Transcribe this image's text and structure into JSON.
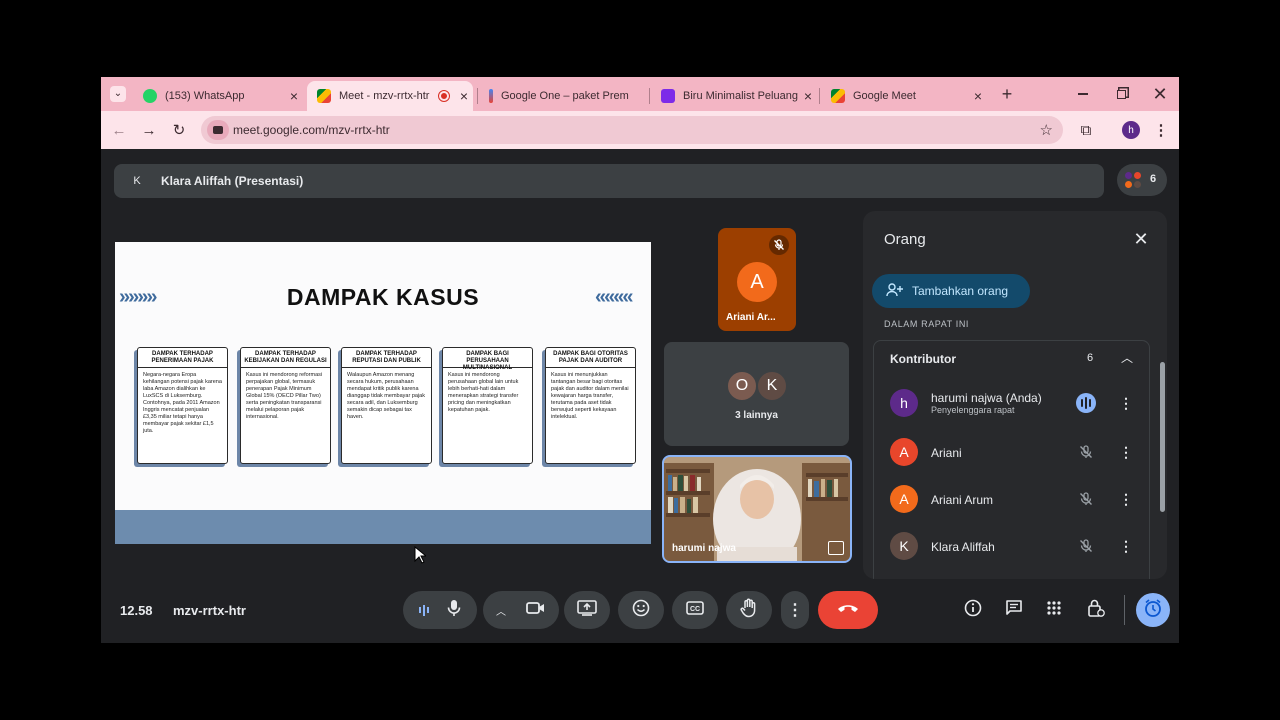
{
  "tabs": [
    {
      "title": "(153) WhatsApp",
      "active": false
    },
    {
      "title": "Meet - mzv-rrtx-htr",
      "active": true
    },
    {
      "title": "Google One – paket Prem",
      "active": false
    },
    {
      "title": "Biru Minimalist Peluang da",
      "active": false
    },
    {
      "title": "Google Meet",
      "active": false
    }
  ],
  "address": {
    "url": "meet.google.com/mzv-rrtx-htr"
  },
  "profile_initial": "h",
  "presenter": {
    "initial": "K",
    "label": "Klara Aliffah (Presentasi)"
  },
  "participant_count": "6",
  "slide": {
    "title": "DAMPAK KASUS",
    "left_chevrons": "»»»»",
    "right_chevrons": "««««",
    "cards": [
      {
        "heading": "DAMPAK TERHADAP PENERIMAAN PAJAK",
        "body": "Negara-negara Eropa kehilangan potensi pajak karena laba Amazon dialihkan ke LuxSCS di Luksemburg. Contohnya, pada 2011 Amazon Inggris mencatat penjualan £3,35 miliar tetapi hanya membayar pajak sekitar £1,5 juta."
      },
      {
        "heading": "DAMPAK TERHADAP KEBIJAKAN DAN REGULASI",
        "body": "Kasus ini mendorong reformasi perpajakan global, termasuk penerapan Pajak Minimum Global 15% (OECD Pillar Two) serta peningkatan transparansi melalui pelaporan pajak internasional."
      },
      {
        "heading": "DAMPAK TERHADAP REPUTASI DAN PUBLIK",
        "body": "Walaupun Amazon menang secara hukum, perusahaan mendapat kritik publik karena dianggap tidak membayar pajak secara adil, dan Luksemburg semakin dicap sebagai tax haven."
      },
      {
        "heading": "DAMPAK BAGI PERUSAHAAN MULTINASIONAL",
        "body": "Kasus ini mendorong perusahaan global lain untuk lebih berhati-hati dalam menerapkan strategi transfer pricing dan meningkatkan kepatuhan pajak."
      },
      {
        "heading": "DAMPAK BAGI OTORITAS PAJAK DAN AUDITOR",
        "body": "Kasus ini menunjukkan tantangan besar bagi otoritas pajak dan auditor dalam menilai kewajaran harga transfer, terutama pada aset tidak berwujud seperti kekayaan intelektual."
      }
    ]
  },
  "tiles": {
    "ariani": {
      "initial": "A",
      "name": "Ariani Ar..."
    },
    "more": {
      "initials": [
        "O",
        "K"
      ],
      "label": "3 lainnya"
    },
    "self": {
      "name": "harumi najwa"
    }
  },
  "panel": {
    "title": "Orang",
    "add_button": "Tambahkan orang",
    "section_label": "DALAM RAPAT INI",
    "group_label": "Kontributor",
    "group_count": "6",
    "people": [
      {
        "initial": "h",
        "name": "harumi najwa (Anda)",
        "sub": "Penyelenggara rapat",
        "color": "#5d2a8a",
        "speaking": true
      },
      {
        "initial": "A",
        "name": "Ariani",
        "sub": "",
        "color": "#e8462b",
        "speaking": false
      },
      {
        "initial": "A",
        "name": "Ariani Arum",
        "sub": "",
        "color": "#f26a1b",
        "speaking": false
      },
      {
        "initial": "K",
        "name": "Klara Aliffah",
        "sub": "",
        "color": "#5f4b44",
        "speaking": false
      }
    ]
  },
  "bottom": {
    "time": "12.58",
    "code": "mzv-rrtx-htr"
  },
  "colors": {
    "accent": "#8ab4f8",
    "hangup": "#ea4335",
    "tabbar": "#f3b5c4"
  }
}
